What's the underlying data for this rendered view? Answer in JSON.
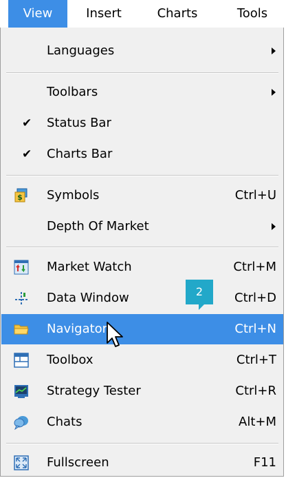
{
  "menubar": {
    "items": [
      {
        "label": "View",
        "active": true
      },
      {
        "label": "Insert"
      },
      {
        "label": "Charts"
      },
      {
        "label": "Tools"
      }
    ]
  },
  "menu": {
    "languages": {
      "label": "Languages"
    },
    "toolbars": {
      "label": "Toolbars"
    },
    "status_bar": {
      "label": "Status Bar",
      "checked": true
    },
    "charts_bar": {
      "label": "Charts Bar",
      "checked": true
    },
    "symbols": {
      "label": "Symbols",
      "shortcut": "Ctrl+U",
      "icon": "symbols-icon"
    },
    "depth_of_market": {
      "label": "Depth Of Market"
    },
    "market_watch": {
      "label": "Market Watch",
      "shortcut": "Ctrl+M",
      "icon": "market-watch-icon"
    },
    "data_window": {
      "label": "Data Window",
      "shortcut": "Ctrl+D",
      "icon": "data-window-icon"
    },
    "navigator": {
      "label": "Navigator",
      "shortcut": "Ctrl+N",
      "icon": "folder-icon",
      "highlighted": true
    },
    "toolbox": {
      "label": "Toolbox",
      "shortcut": "Ctrl+T",
      "icon": "toolbox-icon"
    },
    "strategy_tester": {
      "label": "Strategy Tester",
      "shortcut": "Ctrl+R",
      "icon": "strategy-tester-icon"
    },
    "chats": {
      "label": "Chats",
      "shortcut": "Alt+M",
      "icon": "chats-icon"
    },
    "fullscreen": {
      "label": "Fullscreen",
      "shortcut": "F11",
      "icon": "fullscreen-icon"
    }
  },
  "badge": {
    "label": "2"
  },
  "colors": {
    "highlight": "#3d8ee6",
    "menu_bg": "#f0f0f0",
    "badge": "#22a8c9"
  }
}
